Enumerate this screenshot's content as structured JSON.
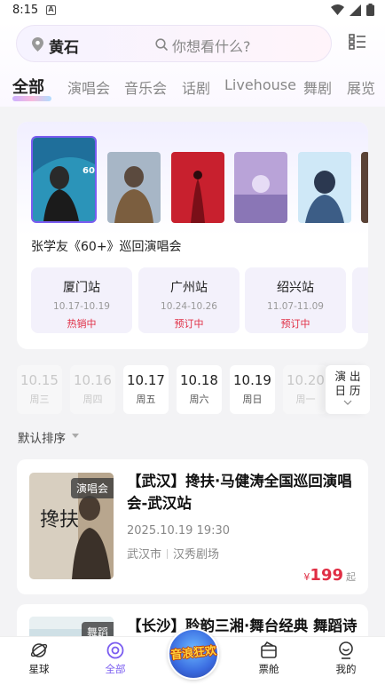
{
  "status_bar": {
    "time": "8:15",
    "notif": "A"
  },
  "header": {
    "city": "黄石",
    "search_placeholder": "你想看什么?",
    "tabs": [
      "全部",
      "演唱会",
      "音乐会",
      "话剧",
      "Livehouse",
      "舞剧",
      "展览"
    ]
  },
  "featured": {
    "title": "张学友《60+》巡回演唱会",
    "poster_text": "60+",
    "stations": [
      {
        "name": "厦门站",
        "dates": "10.17-10.19",
        "status": "热销中"
      },
      {
        "name": "广州站",
        "dates": "10.24-10.26",
        "status": "预订中"
      },
      {
        "name": "绍兴站",
        "dates": "11.07-11.09",
        "status": "预订中"
      }
    ]
  },
  "date_strip": {
    "days": [
      {
        "date": "10.15",
        "weekday": "周三",
        "dim": true
      },
      {
        "date": "10.16",
        "weekday": "周四",
        "dim": true
      },
      {
        "date": "10.17",
        "weekday": "周五",
        "dim": false
      },
      {
        "date": "10.18",
        "weekday": "周六",
        "dim": false
      },
      {
        "date": "10.19",
        "weekday": "周日",
        "dim": false
      },
      {
        "date": "10.20",
        "weekday": "周一",
        "dim": true
      }
    ],
    "calendar_line1": "演 出",
    "calendar_line2": "日 历"
  },
  "sort_label": "默认排序",
  "events": [
    {
      "badge": "演唱会",
      "title": "【武汉】搀扶·马健涛全国巡回演唱会-武汉站",
      "poster_text": "搀扶",
      "time": "2025.10.19 19:30",
      "city": "武汉市",
      "venue": "汉秀剧场",
      "currency": "¥",
      "price": "199",
      "price_suffix": "起"
    },
    {
      "badge": "舞蹈",
      "title": "【长沙】聆韵三湘·舞台经典 舞蹈诗"
    }
  ],
  "bottom_nav": {
    "items": [
      "星球",
      "全部",
      "票舱",
      "我的"
    ],
    "center_label": "音浪狂欢"
  },
  "colors": {
    "accent": "#7a5cf0",
    "price": "#e02e44"
  }
}
